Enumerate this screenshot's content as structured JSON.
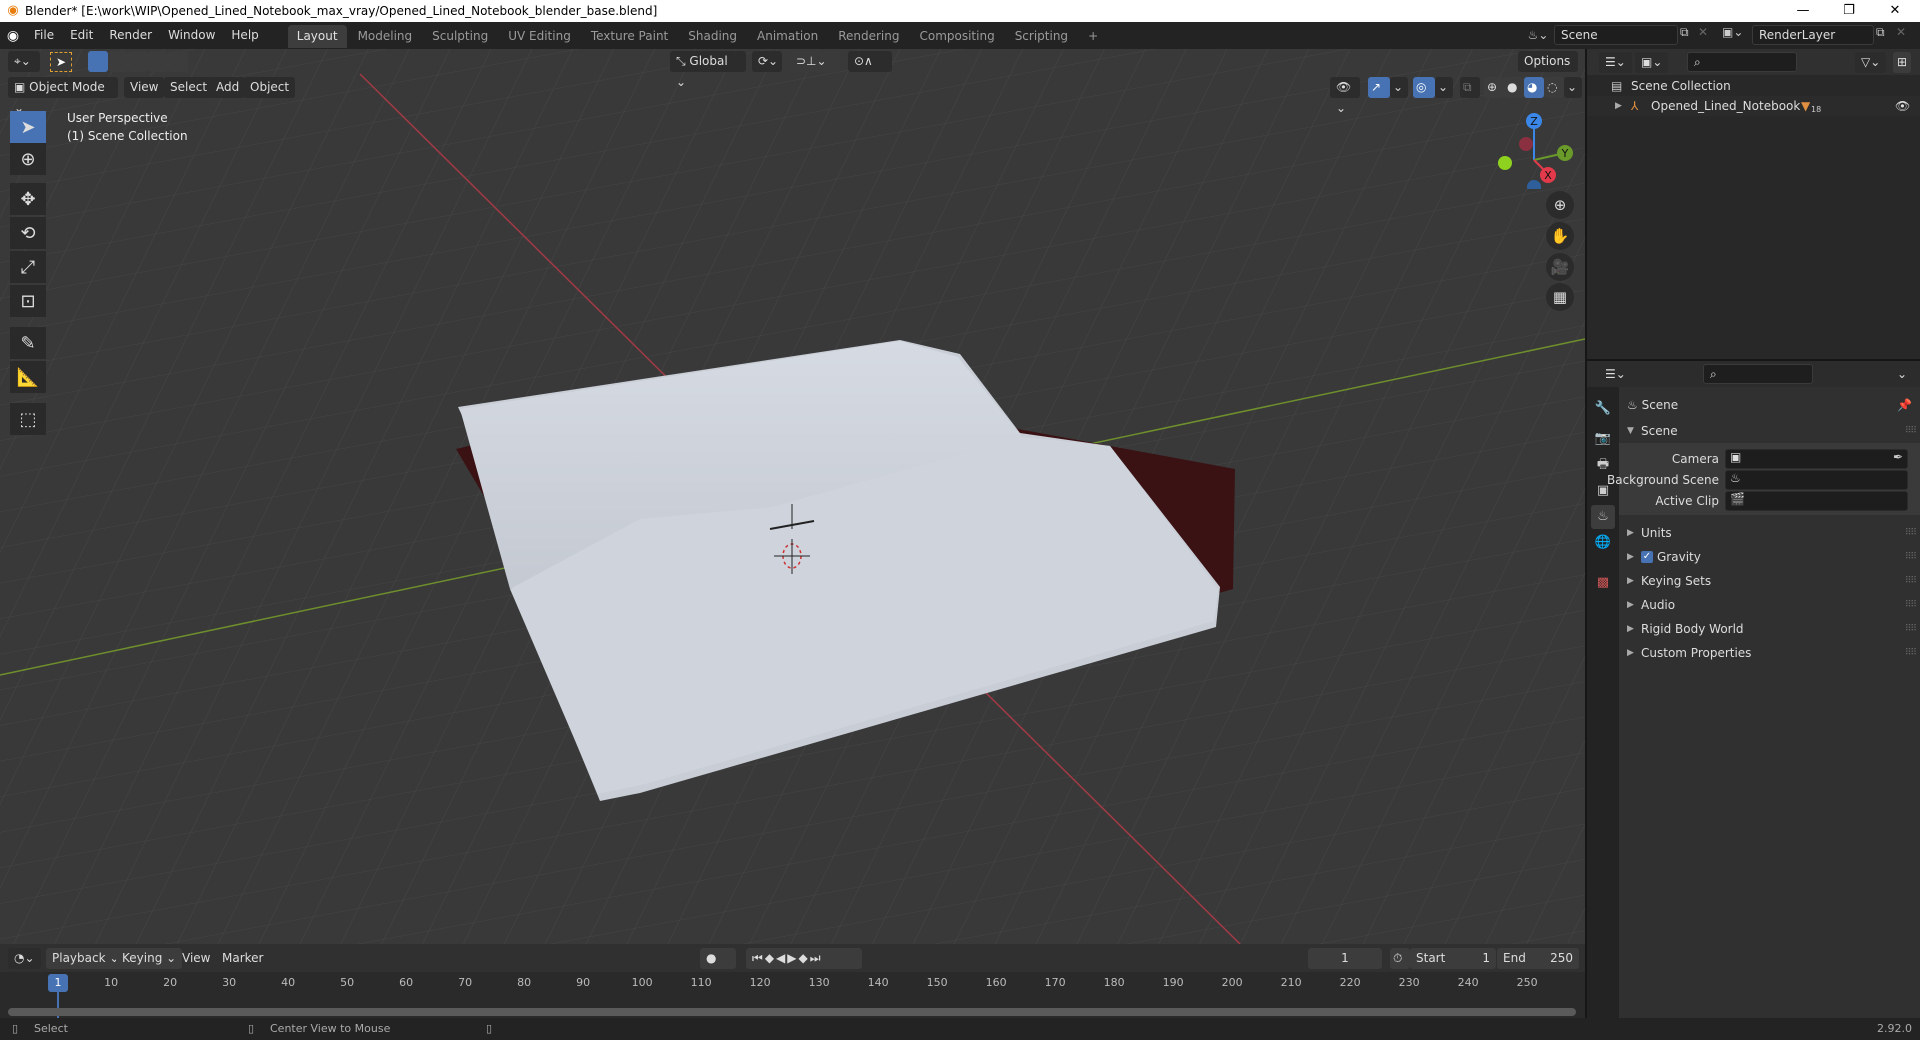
{
  "window": {
    "title": "Blender* [E:\\work\\WIP\\Opened_Lined_Notebook_max_vray/Opened_Lined_Notebook_blender_base.blend]",
    "controls": {
      "minimize": "—",
      "maximize": "❐",
      "close": "✕"
    }
  },
  "menubar": {
    "items": [
      "File",
      "Edit",
      "Render",
      "Window",
      "Help"
    ]
  },
  "workspaces": {
    "tabs": [
      "Layout",
      "Modeling",
      "Sculpting",
      "UV Editing",
      "Texture Paint",
      "Shading",
      "Animation",
      "Rendering",
      "Compositing",
      "Scripting"
    ],
    "active": "Layout",
    "add": "+"
  },
  "scene_selector": {
    "value": "Scene"
  },
  "layer_selector": {
    "value": "RenderLayer"
  },
  "viewport_header": {
    "transform_orientation": "Global",
    "options": "Options",
    "mode": "Object Mode",
    "menus": [
      "View",
      "Select",
      "Add",
      "Object"
    ]
  },
  "viewport": {
    "perspective": "User Perspective",
    "collection": "(1) Scene Collection",
    "gizmo": {
      "z": "Z",
      "y": "Y",
      "x": "X"
    },
    "colors": {
      "x_axis": "#b03040",
      "y_axis": "#7a9c2c",
      "grid": "#4a4a4a",
      "background": "#393939"
    }
  },
  "outliner": {
    "root": "Scene Collection",
    "items": [
      {
        "name": "Opened_Lined_Notebook",
        "badge": "18"
      }
    ]
  },
  "properties": {
    "context": "Scene",
    "panel_title": "Scene",
    "fields": [
      {
        "label": "Camera",
        "value": ""
      },
      {
        "label": "Background Scene",
        "value": ""
      },
      {
        "label": "Active Clip",
        "value": ""
      }
    ],
    "subpanels": [
      {
        "label": "Units"
      },
      {
        "label": "Gravity",
        "checked": true
      },
      {
        "label": "Keying Sets"
      },
      {
        "label": "Audio"
      },
      {
        "label": "Rigid Body World"
      },
      {
        "label": "Custom Properties"
      }
    ]
  },
  "timeline": {
    "menus": [
      "Playback",
      "Keying",
      "View",
      "Marker"
    ],
    "current_frame": "1",
    "start_label": "Start",
    "start": "1",
    "end_label": "End",
    "end": "250",
    "ticks": [
      "10",
      "20",
      "30",
      "40",
      "50",
      "60",
      "70",
      "80",
      "90",
      "100",
      "110",
      "120",
      "130",
      "140",
      "150",
      "160",
      "170",
      "180",
      "190",
      "200",
      "210",
      "220",
      "230",
      "240",
      "250"
    ],
    "playhead": "1"
  },
  "statusbar": {
    "left_hint": "Select",
    "middle_hint": "Center View to Mouse",
    "version": "2.92.0"
  }
}
